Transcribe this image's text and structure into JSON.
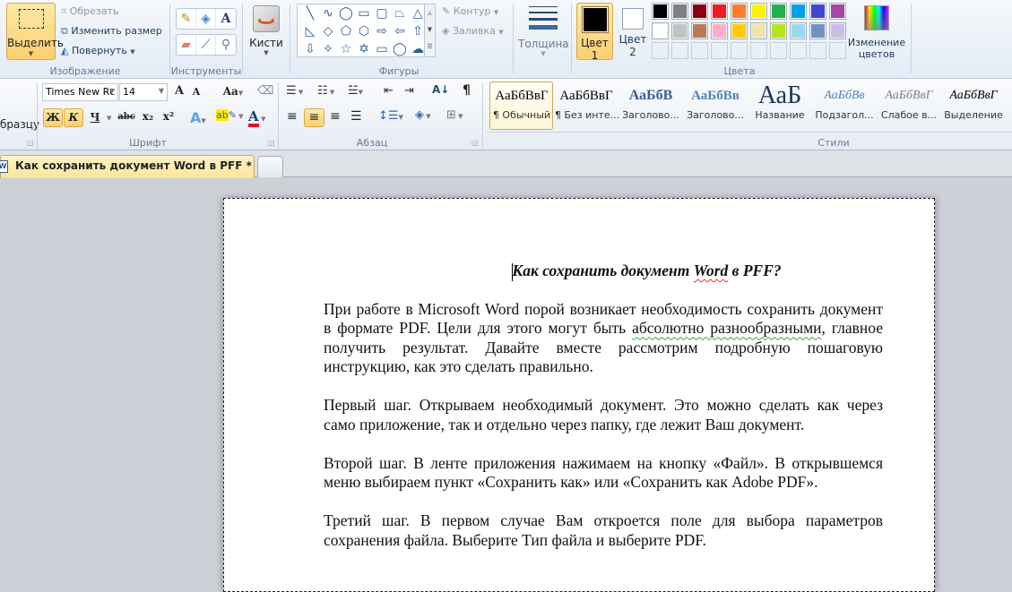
{
  "ribbon_top": {
    "image_group": {
      "label": "Изображение",
      "select_label": "Выделить",
      "crop_label": "Обрезать",
      "resize_label": "Изменить размер",
      "rotate_label": "Повернуть"
    },
    "tools_group": {
      "label": "Инструменты",
      "tools": [
        "pencil-icon",
        "fill-bucket-icon",
        "text-icon",
        "eraser-icon",
        "color-picker-icon",
        "magnifier-icon"
      ]
    },
    "brushes_label": "Кисти",
    "shapes_group": {
      "label": "Фигуры",
      "shapes": [
        "line",
        "curve",
        "oval",
        "rectangle",
        "rounded-rectangle",
        "polygon",
        "triangle",
        "right-triangle",
        "diamond",
        "pentagon",
        "hexagon",
        "right-arrow",
        "left-arrow",
        "up-arrow",
        "down-arrow",
        "four-point-star",
        "five-point-star",
        "six-point-star",
        "rounded-callout",
        "oval-callout",
        "cloud-callout"
      ],
      "outline_label": "Контур",
      "fill_label": "Заливка"
    },
    "size_label": "Толщина",
    "colors_group": {
      "label": "Цвета",
      "color1_label": "Цвет",
      "color1_num": "1",
      "color2_label": "Цвет",
      "color2_num": "2",
      "color1_value": "#000000",
      "color2_value": "#ffffff",
      "palette_row1": [
        "#000000",
        "#7f7f7f",
        "#880015",
        "#ed1c24",
        "#ff7f27",
        "#fff200",
        "#22b14c",
        "#00a2e8",
        "#3f48cc",
        "#a349a4"
      ],
      "palette_row2": [
        "#ffffff",
        "#c3c3c3",
        "#b97a57",
        "#ffaec9",
        "#ffc90e",
        "#efe4b0",
        "#b5e61d",
        "#99d9ea",
        "#7092be",
        "#c8bfe7"
      ],
      "edit_colors_label1": "Изменение",
      "edit_colors_label2": "цветов"
    }
  },
  "ribbon_bottom": {
    "clipboard_partial_label": "бразцу",
    "font_group": {
      "label": "Шрифт",
      "font_name": "Times New Rc",
      "font_size": "14",
      "bold": "Ж",
      "italic": "К",
      "underline": "Ч",
      "strike": "abc",
      "subscript": "x₂",
      "superscript": "x²",
      "grow": "A",
      "shrink": "A",
      "change_case": "Aa",
      "font_color_value": "#e81123"
    },
    "paragraph_group": {
      "label": "Абзац",
      "pilcrow": "¶",
      "sort": "А↓"
    },
    "styles_group": {
      "label": "Стили",
      "items": [
        {
          "preview": "АаБбВвГ",
          "name": "¶ Обычный"
        },
        {
          "preview": "АаБбВвГ",
          "name": "¶ Без инте..."
        },
        {
          "preview": "АаБбВ",
          "name": "Заголово..."
        },
        {
          "preview": "АаБбВв",
          "name": "Заголово..."
        },
        {
          "preview": "АаБ",
          "name": "Название"
        },
        {
          "preview": "АаБбВв",
          "name": "Подзагол..."
        },
        {
          "preview": "АаБбВвГ",
          "name": "Слабое в..."
        },
        {
          "preview": "АаБбВвГ",
          "name": "Выделение"
        }
      ]
    }
  },
  "tab": {
    "title": "Как сохранить документ Word в PFF *",
    "close": "×"
  },
  "document": {
    "title_pre": "Как сохранить документ ",
    "title_word": "Word",
    "title_post": " в PFF?",
    "p1_a": "При работе в Microsoft Word порой возникает необходимость сохранить документ в формате PDF. Цели для этого могут быть ",
    "p1_b": "абсолютно разнообразными",
    "p1_c": ", главное получить результат. Давайте вместе рассмотрим подробную пошаговую инструкцию, как это сделать правильно.",
    "p2": "Первый шаг. Открываем необходимый документ. Это можно сделать как через само приложение, так и отдельно через папку, где лежит Ваш документ.",
    "p3": "Второй шаг. В ленте приложения нажимаем на кнопку «Файл». В открывшемся меню выбираем пункт «Сохранить как» или «Сохранить как Adobe PDF».",
    "p4": "Третий шаг. В первом случае Вам откроется поле для выбора параметров сохранения файла. Выберите Тип файла и выберите PDF."
  }
}
